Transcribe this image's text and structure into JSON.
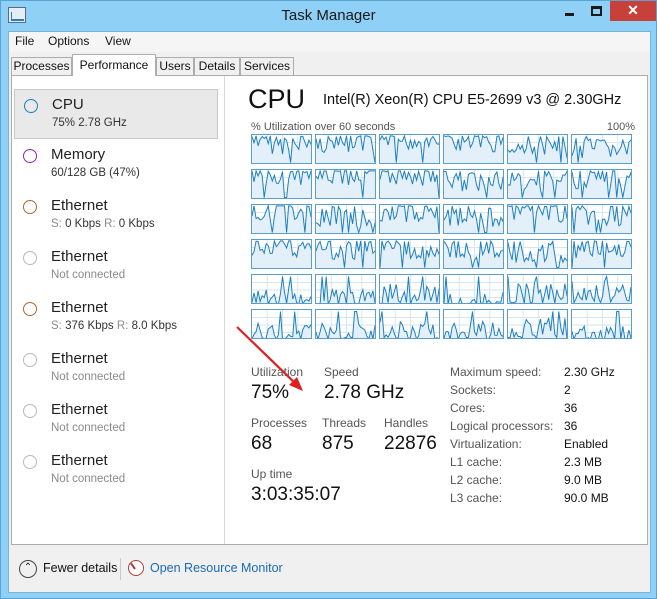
{
  "window": {
    "title": "Task Manager",
    "close_glyph": "✕"
  },
  "menu": [
    "File",
    "Options",
    "View"
  ],
  "tabs": [
    "Processes",
    "Performance",
    "Users",
    "Details",
    "Services"
  ],
  "active_tab": "Performance",
  "sidebar": [
    {
      "name": "CPU",
      "sub": "75%  2.78 GHz",
      "ring": "#1e7fc0",
      "selected": true
    },
    {
      "name": "Memory",
      "sub": "60/128 GB (47%)",
      "ring": "#8b2ba6"
    },
    {
      "name": "Ethernet",
      "s_label": "S:",
      "s_value": "0 Kbps",
      "r_label": "R:",
      "r_value": "0 Kbps",
      "ring": "#b5652b"
    },
    {
      "name": "Ethernet",
      "sub": "Not connected",
      "ring": "#b9b9b9"
    },
    {
      "name": "Ethernet",
      "s_label": "S:",
      "s_value": "376 Kbps",
      "r_label": "R:",
      "r_value": "8.0 Kbps",
      "ring": "#b5652b"
    },
    {
      "name": "Ethernet",
      "sub": "Not connected",
      "ring": "#b9b9b9"
    },
    {
      "name": "Ethernet",
      "sub": "Not connected",
      "ring": "#b9b9b9"
    },
    {
      "name": "Ethernet",
      "sub": "Not connected",
      "ring": "#b9b9b9"
    }
  ],
  "cpu": {
    "title": "CPU",
    "model": "Intel(R) Xeon(R) CPU E5-2699 v3 @ 2.30GHz",
    "util_caption": "% Utilization over 60 seconds",
    "util_max": "100%",
    "graph_rows": 6,
    "graph_cols": 6,
    "line_color": "#1e7fc0",
    "stats": {
      "utilization_label": "Utilization",
      "utilization": "75%",
      "speed_label": "Speed",
      "speed": "2.78 GHz",
      "processes_label": "Processes",
      "processes": "68",
      "threads_label": "Threads",
      "threads": "875",
      "handles_label": "Handles",
      "handles": "22876",
      "uptime_label": "Up time",
      "uptime": "3:03:35:07"
    },
    "specs": [
      {
        "label": "Maximum speed:",
        "value": "2.30 GHz"
      },
      {
        "label": "Sockets:",
        "value": "2"
      },
      {
        "label": "Cores:",
        "value": "36"
      },
      {
        "label": "Logical processors:",
        "value": "36"
      },
      {
        "label": "Virtualization:",
        "value": "Enabled"
      },
      {
        "label": "L1 cache:",
        "value": "2.3 MB"
      },
      {
        "label": "L2 cache:",
        "value": "9.0 MB"
      },
      {
        "label": "L3 cache:",
        "value": "90.0 MB"
      }
    ]
  },
  "footer": {
    "fewer_details": "Fewer details",
    "resource_monitor": "Open Resource Monitor",
    "fewer_glyph": "⌃"
  },
  "annotation": {
    "arrow_color": "#e02020"
  }
}
